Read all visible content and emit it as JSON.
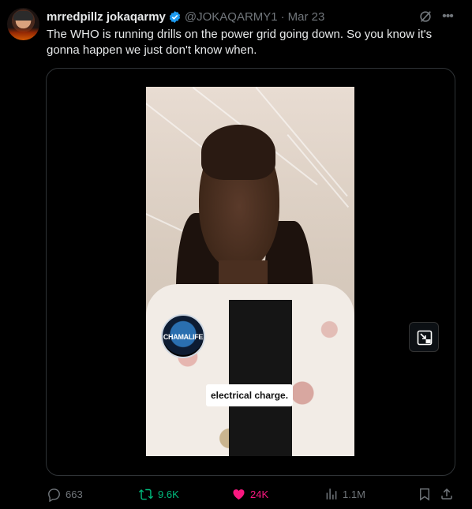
{
  "author": {
    "name": "mrredpillz jokaqarmy",
    "handle": "@JOKAQARMY1",
    "separator": "·",
    "date": "Mar 23"
  },
  "tweet": {
    "text": "The WHO is running drills on the power grid going down. So you know it's gonna happen we just don't know when."
  },
  "media": {
    "watermark_text": "CHAMALIFE",
    "caption": "electrical charge."
  },
  "actions": {
    "replies": "663",
    "reposts": "9.6K",
    "likes": "24K",
    "views": "1.1M"
  },
  "colors": {
    "verified": "#1d9bf0",
    "repost": "#00ba7c",
    "like": "#f91880",
    "muted": "#71767b"
  },
  "icons": [
    "verified-badge-icon",
    "grok-icon",
    "more-icon",
    "pip-icon",
    "reply-icon",
    "repost-icon",
    "like-icon",
    "views-icon",
    "bookmark-icon",
    "share-icon"
  ]
}
